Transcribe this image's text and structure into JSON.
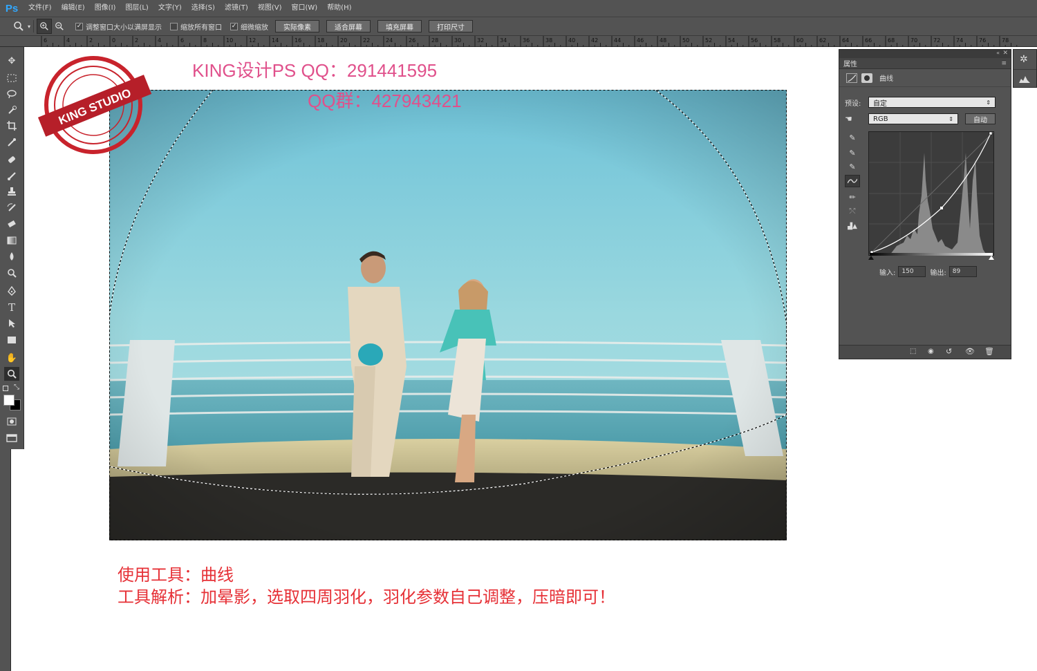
{
  "app": {
    "logo": "Ps"
  },
  "menu": [
    "文件(F)",
    "编辑(E)",
    "图像(I)",
    "图层(L)",
    "文字(Y)",
    "选择(S)",
    "滤镜(T)",
    "视图(V)",
    "窗口(W)",
    "帮助(H)"
  ],
  "options": {
    "resize_windows": "调整窗口大小以满屏显示",
    "zoom_all": "缩放所有窗口",
    "scrubby_zoom": "细微缩放",
    "btn_actual": "实际像素",
    "btn_fit": "适合屏幕",
    "btn_fill": "填充屏幕",
    "btn_print": "打印尺寸"
  },
  "ruler_top": [
    "6",
    "4",
    "2",
    "0",
    "2",
    "4",
    "6",
    "8",
    "10",
    "12",
    "14",
    "16",
    "18",
    "20",
    "22",
    "24",
    "26",
    "28",
    "30",
    "32",
    "34",
    "36",
    "38",
    "40",
    "42",
    "44",
    "46",
    "48",
    "50",
    "52",
    "54",
    "56",
    "58",
    "60",
    "62",
    "64",
    "66",
    "68",
    "70",
    "72",
    "74",
    "76",
    "78"
  ],
  "watermark": {
    "line1": "KING设计PS    QQ：291441595",
    "line2": "QQ群：427943421",
    "stamp_text": "KING STUDIO"
  },
  "captions": {
    "line1": "使用工具：曲线",
    "line2": "工具解析：加晕影，选取四周羽化，羽化参数自己调整，压暗即可！"
  },
  "panel": {
    "tab": "属性",
    "title": "曲线",
    "preset_label": "预设:",
    "preset_value": "自定",
    "channel_value": "RGB",
    "auto_button": "自动",
    "input_label": "输入:",
    "input_value": "150",
    "output_label": "输出:",
    "output_value": "89"
  },
  "colors": {
    "ui_bg": "#535353",
    "watermark": "#e0508b",
    "caption": "#e63036",
    "sky": "#8fd3de"
  }
}
